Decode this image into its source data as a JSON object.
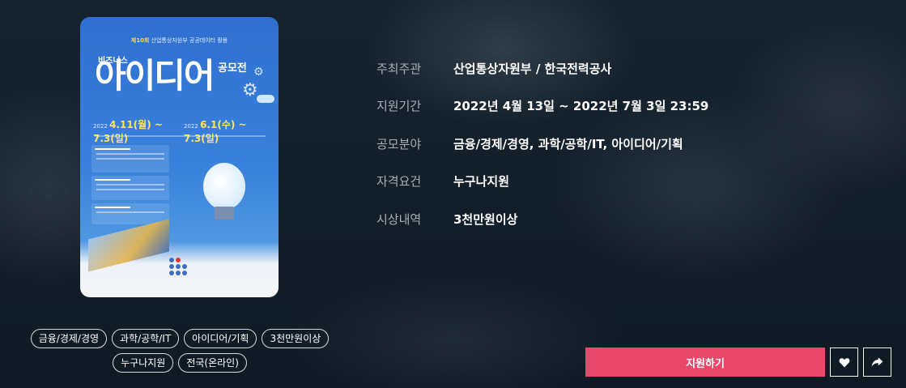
{
  "poster": {
    "alt": "제10회 산업통상자원부 공공데이터 활용 비즈니스 아이디어 공모전 포스터",
    "top_line_badge": "제10회",
    "top_line": "산업통상자원부 공공데이터 활용",
    "biz": "비즈니스",
    "main": "아이디어",
    "contest": "공모전",
    "date1": "4.11(월) ~ 7.3(일)",
    "date2": "6.1(수) ~ 7.3(일)",
    "year": "2022"
  },
  "info": {
    "rows": [
      {
        "label": "주최주관",
        "value": "산업통상자원부 / 한국전력공사"
      },
      {
        "label": "지원기간",
        "value": "2022년 4월 13일 ~ 2022년 7월 3일 23:59"
      },
      {
        "label": "공모분야",
        "value": "금융/경제/경영, 과학/공학/IT, 아이디어/기획"
      },
      {
        "label": "자격요건",
        "value": "누구나지원"
      },
      {
        "label": "시상내역",
        "value": "3천만원이상"
      }
    ]
  },
  "tags": {
    "row1": [
      "금융/경제/경영",
      "과학/공학/IT",
      "아이디어/기획",
      "3천만원이상"
    ],
    "row2": [
      "누구나지원",
      "전국(온라인)"
    ]
  },
  "actions": {
    "apply_label": "지원하기",
    "like_icon": "heart-icon",
    "share_icon": "share-icon"
  }
}
